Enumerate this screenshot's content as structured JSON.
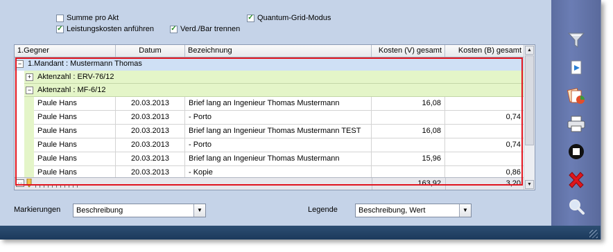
{
  "options": {
    "summe_pro_akt": {
      "label": "Summe pro Akt",
      "checked": false
    },
    "leistungskosten": {
      "label": "Leistungskosten anführen",
      "checked": true
    },
    "quantum_grid": {
      "label": "Quantum-Grid-Modus",
      "checked": true
    },
    "verd_bar": {
      "label": "Verd./Bar trennen",
      "checked": true
    }
  },
  "grid": {
    "columns": [
      "1.Gegner",
      "Datum",
      "Bezeichnung",
      "Kosten (V) gesamt",
      "Kosten (B) gesamt"
    ],
    "mandant_label": "1.Mandant : Mustermann Thomas",
    "groups": [
      "Aktenzahl : ERV-76/12",
      "Aktenzahl : MF-6/12"
    ],
    "rows": [
      {
        "gegner": "Paule Hans",
        "datum": "20.03.2013",
        "bezeichnung": "Brief lang an Ingenieur Thomas Mustermann",
        "kosten_v": "16,08",
        "kosten_b": ""
      },
      {
        "gegner": "Paule Hans",
        "datum": "20.03.2013",
        "bezeichnung": "- Porto",
        "kosten_v": "",
        "kosten_b": "0,74"
      },
      {
        "gegner": "Paule Hans",
        "datum": "20.03.2013",
        "bezeichnung": "Brief lang an Ingenieur Thomas Mustermann TEST",
        "kosten_v": "16,08",
        "kosten_b": ""
      },
      {
        "gegner": "Paule Hans",
        "datum": "20.03.2013",
        "bezeichnung": "- Porto",
        "kosten_v": "",
        "kosten_b": "0,74"
      },
      {
        "gegner": "Paule Hans",
        "datum": "20.03.2013",
        "bezeichnung": "Brief lang an Ingenieur Thomas Mustermann",
        "kosten_v": "15,96",
        "kosten_b": ""
      },
      {
        "gegner": "Paule Hans",
        "datum": "20.03.2013",
        "bezeichnung": "- Kopie",
        "kosten_v": "",
        "kosten_b": "0,86"
      }
    ],
    "footer": {
      "sum_v": "163,92",
      "sum_b": "3,20"
    }
  },
  "markierungen": {
    "label": "Markierungen",
    "value": "Beschreibung"
  },
  "legende": {
    "label": "Legende",
    "value": "Beschreibung, Wert"
  },
  "colors": {
    "window_bg": "#c5d3e8",
    "toolbar_bg": "#6476ab",
    "group_row": "#e4f5c8",
    "mandant_row": "#cfe0f5",
    "highlight": "#e0141e",
    "status_bar": "#1f3d60"
  },
  "toolbar_icons": [
    "filter-icon",
    "export-icon",
    "report-icon",
    "print-icon",
    "stop-icon",
    "delete-icon",
    "search-icon"
  ]
}
